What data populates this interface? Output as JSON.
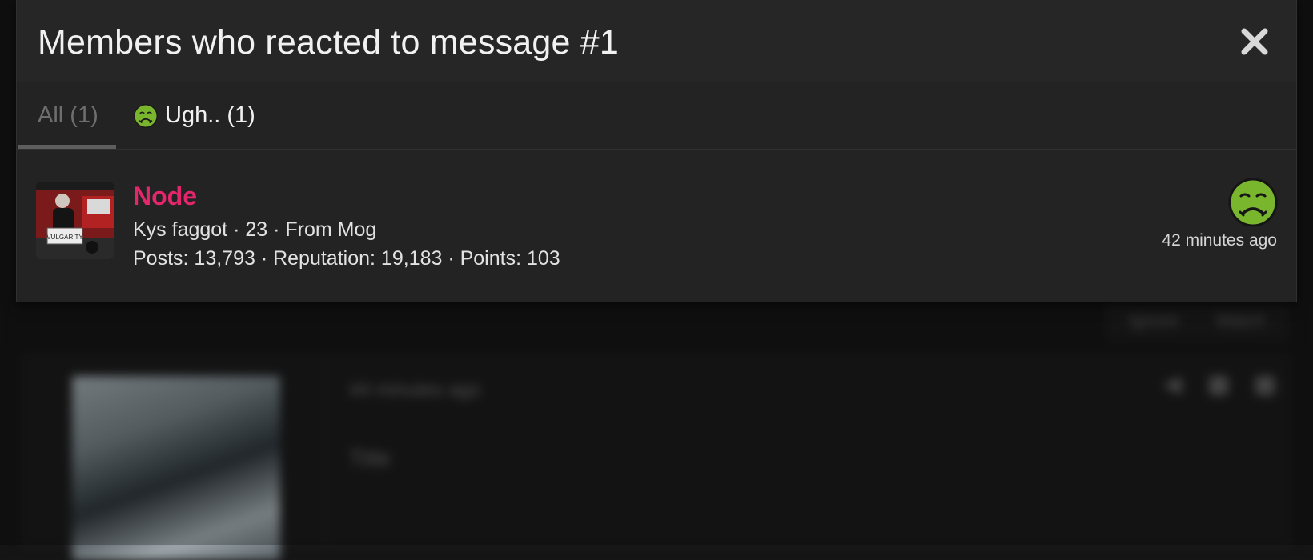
{
  "background": {
    "actions": [
      "Ignore",
      "Watch"
    ],
    "post_time": "44 minutes ago",
    "post_title": "Title"
  },
  "modal": {
    "title": "Members who reacted to message #1",
    "close_icon": "close-icon",
    "tabs": [
      {
        "label": "All (1)",
        "active": true
      },
      {
        "label": "Ugh.. (1)",
        "active": false,
        "icon": "nauseated-face-icon"
      }
    ],
    "members": [
      {
        "name": "Node",
        "info": "Kys faggot · 23 · From Mog",
        "stats": "Posts: 13,793 · Reputation: 19,183 · Points: 103",
        "reaction_icon": "nauseated-face-icon",
        "reaction_time": "42 minutes ago",
        "avatar_sign": "VULGARITY"
      }
    ]
  },
  "colors": {
    "username": "#e5266c",
    "modal_bg": "#232323",
    "page_bg": "#151515",
    "emoji_green": "#7ab52e"
  }
}
